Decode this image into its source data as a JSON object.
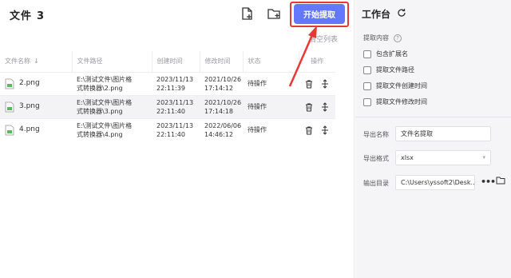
{
  "header": {
    "title": "文件",
    "file_count": "3",
    "start_label": "开始提取",
    "clear_label": "清空列表"
  },
  "table": {
    "columns": [
      "文件名称",
      "文件路径",
      "创建时间",
      "修改时间",
      "状态",
      "操作"
    ],
    "rows": [
      {
        "name": "2.png",
        "path1": "E:\\测试文件\\图片格",
        "path2": "式转换器\\2.png",
        "ctime1": "2023/11/13",
        "ctime2": "22:11:39",
        "mtime1": "2021/10/26",
        "mtime2": "17:14:12",
        "status": "待操作"
      },
      {
        "name": "3.png",
        "path1": "E:\\测试文件\\图片格",
        "path2": "式转换器\\3.png",
        "ctime1": "2023/11/13",
        "ctime2": "22:11:40",
        "mtime1": "2021/10/26",
        "mtime2": "17:14:18",
        "status": "待操作"
      },
      {
        "name": "4.png",
        "path1": "E:\\测试文件\\图片格",
        "path2": "式转换器\\4.png",
        "ctime1": "2023/11/13",
        "ctime2": "22:11:40",
        "mtime1": "2022/06/06",
        "mtime2": "14:46:12",
        "status": "待操作"
      }
    ]
  },
  "workspace": {
    "title": "工作台",
    "extract_label": "提取内容",
    "options": [
      "包含扩展名",
      "提取文件路径",
      "提取文件创建时间",
      "提取文件修改时间"
    ],
    "export_name_label": "导出名称",
    "export_name_value": "文件名提取",
    "export_format_label": "导出格式",
    "export_format_value": "xlsx",
    "output_dir_label": "输出目录",
    "output_dir_value": "C:\\Users\\yssoft2\\Desk..."
  },
  "colors": {
    "accent": "#6478ff",
    "highlight": "#e53935"
  }
}
